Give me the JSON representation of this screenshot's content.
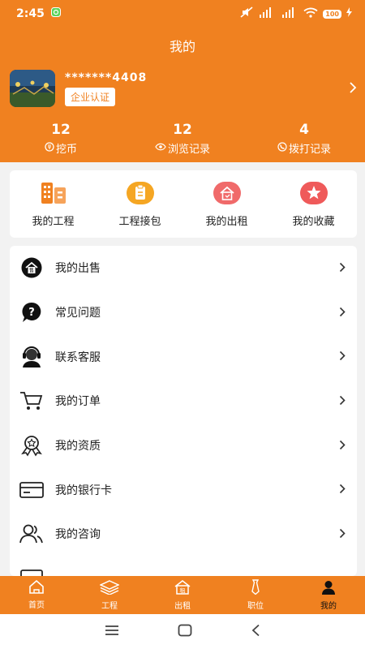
{
  "status_bar": {
    "time": "2:45",
    "battery": "100"
  },
  "header": {
    "title": "我的"
  },
  "profile": {
    "phone": "*******4408",
    "cert_button": "企业认证"
  },
  "stats": [
    {
      "value": "12",
      "label": "挖币",
      "icon": "coin-icon"
    },
    {
      "value": "12",
      "label": "浏览记录",
      "icon": "eye-icon"
    },
    {
      "value": "4",
      "label": "拨打记录",
      "icon": "phone-icon"
    }
  ],
  "quick_actions": [
    {
      "label": "我的工程",
      "icon": "building-icon",
      "color": "#f08120"
    },
    {
      "label": "工程接包",
      "icon": "clipboard-icon",
      "color": "#f5a623"
    },
    {
      "label": "我的出租",
      "icon": "rent-house-icon",
      "color": "#f06a6a"
    },
    {
      "label": "我的收藏",
      "icon": "star-icon",
      "color": "#ef5a5a"
    }
  ],
  "menu": [
    {
      "label": "我的出售",
      "icon": "sale-house-icon"
    },
    {
      "label": "常见问题",
      "icon": "question-icon"
    },
    {
      "label": "联系客服",
      "icon": "headset-icon"
    },
    {
      "label": "我的订单",
      "icon": "cart-icon"
    },
    {
      "label": "我的资质",
      "icon": "award-icon"
    },
    {
      "label": "我的银行卡",
      "icon": "bank-card-icon"
    },
    {
      "label": "我的咨询",
      "icon": "consult-icon"
    }
  ],
  "tabs": [
    {
      "label": "首页",
      "icon": "home-icon"
    },
    {
      "label": "工程",
      "icon": "layers-icon"
    },
    {
      "label": "出租",
      "icon": "rent-icon"
    },
    {
      "label": "职位",
      "icon": "tie-icon"
    },
    {
      "label": "我的",
      "icon": "person-icon",
      "active": true
    }
  ],
  "colors": {
    "brand": "#f08120",
    "background": "#f2f2f2"
  }
}
